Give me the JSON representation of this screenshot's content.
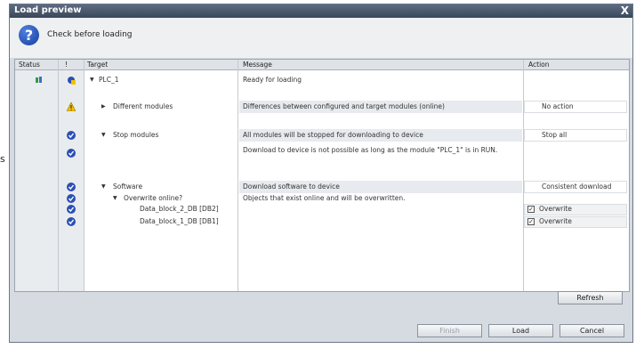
{
  "window": {
    "title": "Load preview",
    "close_glyph": "X"
  },
  "header": {
    "text": "Check before loading",
    "icon": "question-icon"
  },
  "columns": {
    "status": "Status",
    "alert": "!",
    "target": "Target",
    "message": "Message",
    "action": "Action"
  },
  "rows": [
    {
      "status_icon": "network-icon",
      "alert_icon": "device-warning-icon",
      "expander": "down",
      "target": "PLC_1",
      "message": "Ready for loading",
      "action": ""
    },
    {
      "alert_icon": "warning-icon",
      "expander": "right",
      "target": "Different modules",
      "message": "Differences between configured and target modules (online)",
      "action": "No action"
    },
    {
      "alert_icon": "check-icon",
      "expander": "down",
      "target": "Stop modules",
      "message": "All modules will be stopped for downloading to device",
      "action": "Stop all"
    },
    {
      "alert_icon": "check-icon",
      "target": "",
      "message": "Download to device is not possible as long as the module \"PLC_1\" is in RUN.",
      "action": ""
    },
    {
      "alert_icon": "check-icon",
      "expander": "down",
      "target": "Software",
      "message": "Download software to device",
      "action": "Consistent download"
    },
    {
      "alert_icon": "check-icon",
      "expander": "down",
      "target": "Overwrite online?",
      "message": "Objects that exist online and will be overwritten.",
      "action": ""
    },
    {
      "alert_icon": "check-icon",
      "target": "Data_block_2_DB [DB2]",
      "message": "",
      "action": "Overwrite",
      "checked": true
    },
    {
      "alert_icon": "check-icon",
      "target": "Data_block_1_DB [DB1]",
      "message": "",
      "action": "Overwrite",
      "checked": true
    }
  ],
  "buttons": {
    "refresh": "Refresh",
    "finish": "Finish",
    "load": "Load",
    "cancel": "Cancel"
  },
  "edge_text": "s",
  "colors": {
    "check": "#2b4fb5",
    "warning": "#f2c200",
    "titlebar": "#3a475a"
  }
}
